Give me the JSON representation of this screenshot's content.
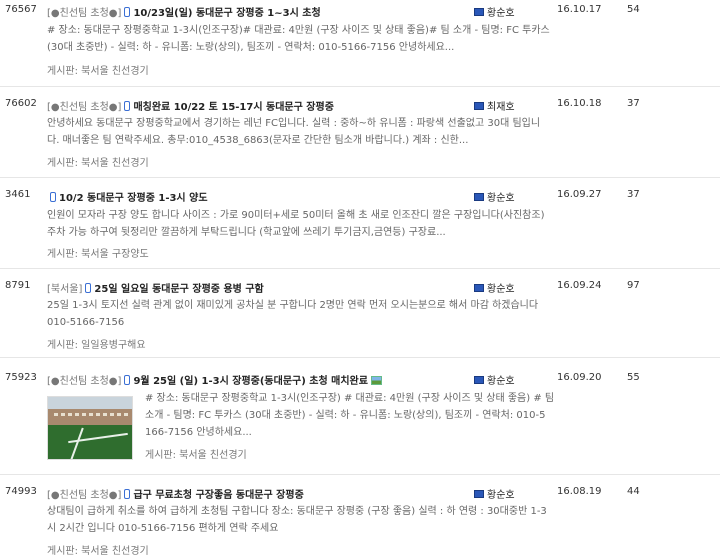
{
  "posts": [
    {
      "id": "76567",
      "category": "[●친선팀 초청●]",
      "title": "10/23일(일) 동대문구 장평중 1~3시 초청",
      "author": "황순호",
      "date": "16.10.17",
      "views": "54",
      "snippet1": "# 장소: 동대문구 장평중학교 1-3시(인조구장)# 대관료: 4만원 (구장 사이즈 및 상태 좋음)# 팀 소개 - 팀명: FC 투카스",
      "snippet2": "(30대 초중반) - 실력: 하 - 유니폼: 노랑(상의), 팀조끼 - 연락처: 010-5166-7156 안녕하세요...",
      "board": "게시판: 북서울 친선경기"
    },
    {
      "id": "76602",
      "category": "[●친선팀 초청●]",
      "title": "매칭완료 10/22 토 15-17시 동대문구 장평중",
      "author": "최재호",
      "date": "16.10.18",
      "views": "37",
      "snippet1": "안녕하세요 동대문구 장평중학교에서 경기하는 레넌 FC입니다. 실력 : 중하~하 유니폼 : 파랑색 선출없고 30대 팀입니",
      "snippet2": "다. 매너좋은 팀 연락주세요. 총무:010_4538_6863(문자로 간단한 팀소개 바랍니다.) 계좌 : 신한...",
      "board": "게시판: 북서울 친선경기"
    },
    {
      "id": "3461",
      "category": "",
      "title": "10/2 동대문구 장평중 1-3시 양도",
      "author": "황순호",
      "date": "16.09.27",
      "views": "37",
      "snippet1": "인원이 모자라 구장 양도 합니다 사이즈 : 가로 90미터+세로 50미터 올해 초 새로 인조잔디 깔은 구장입니다(사진참조)",
      "snippet2": "주차 가능 하구여 뒷정리만 깔끔하게 부탁드립니다 (학교앞에 쓰레기 투기금지,금연등) 구장료...",
      "board": "게시판: 북서울 구장양도"
    },
    {
      "id": "8791",
      "category": "[북서울]",
      "title": "25일 일요일 동대문구 장평중 용병 구함",
      "author": "황순호",
      "date": "16.09.24",
      "views": "97",
      "snippet1": "25일 1-3시 토지선 실력 관계 없이 재미있게 공차실 분 구합니다 2명만 연락 먼저 오시는분으로 해서 마감 하겠습니다",
      "snippet2": "010-5166-7156",
      "board": "게시판: 일일용병구해요"
    },
    {
      "id": "75923",
      "category": "[●친선팀 초청●]",
      "title": "9월 25일 (일) 1-3시 장평중(동대문구) 초청 매치완료",
      "author": "황순호",
      "date": "16.09.20",
      "views": "55",
      "snippet1": "# 장소: 동대문구 장평중학교 1-3시(인조구장) # 대관료: 4만원 (구장 사이즈 및 상태 좋음) # 팀",
      "snippet2": "소개 - 팀명: FC 투카스 (30대 초중반) - 실력: 하 - 유니폼: 노랑(상의), 팀조끼 - 연락처: 010-5",
      "snippet3": "166-7156 안녕하세요...",
      "board": "게시판: 북서울 친선경기"
    },
    {
      "id": "74993",
      "category": "[●친선팀 초청●]",
      "title": "급구 무료초청 구장좋음 동대문구 장평중",
      "author": "황순호",
      "date": "16.08.19",
      "views": "44",
      "snippet1": "상대팀이 급하게 취소를 하여 급하게 초청팀 구합니다 장소: 동대문구 장평중 (구장 좋음) 실력 : 하 연령 : 30대중반 1-3",
      "snippet2": "시 2시간 입니다 010-5166-7156 편하게 연락 주세요",
      "board": "게시판: 북서울 친선경기"
    }
  ]
}
